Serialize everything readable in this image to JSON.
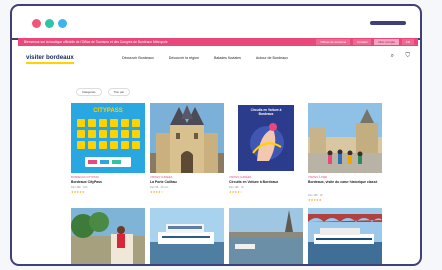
{
  "promo_bar": {
    "text": "Bienvenue sur la boutique officielle de l'Office de Tourisme et des Congrès de Bordeaux Métropole",
    "links": [
      "Offices de tourisme",
      "Contact",
      "Mon compte",
      "FR"
    ]
  },
  "header": {
    "logo": "visiter bordeaux",
    "nav": [
      "Découvrir Bordeaux",
      "Découvrir la région",
      "Balades fluviales",
      "Autour de Bordeaux"
    ]
  },
  "filters": [
    "Catégories",
    "Trier par"
  ],
  "cards": [
    {
      "category": "BORDEAUX CITYPASS",
      "title": "Bordeaux CityPass",
      "meta": "Dès 39€ · 24h",
      "stars": "★★★★★"
    },
    {
      "category": "VISITES GUIDÉES",
      "title": "La Porte Cailhau",
      "meta": "Dès 5€ · 45 min",
      "stars": "★★★★☆"
    },
    {
      "category": "VISITES GUIDÉES",
      "title": "Circuits en Voiture à Bordeaux",
      "meta": "Dès 19€ · 2h",
      "stars": "★★★★☆"
    },
    {
      "category": "VISITES À PIED",
      "title": "Bordeaux, visite du cœur historique classé",
      "meta": "Dès 15€ · 2h",
      "stars": "★★★★★"
    },
    {
      "category": "",
      "title": "",
      "meta": "",
      "stars": ""
    },
    {
      "category": "",
      "title": "",
      "meta": "",
      "stars": ""
    },
    {
      "category": "",
      "title": "",
      "meta": "",
      "stars": ""
    },
    {
      "category": "",
      "title": "",
      "meta": "",
      "stars": ""
    }
  ],
  "cover_texts": {
    "citypass": "CITYPASS",
    "circuits": "Circuits en Voiture à Bordeaux"
  },
  "icons": {
    "search": "search-icon",
    "cart": "cart-icon"
  },
  "colors": {
    "accent": "#e8487c",
    "frame": "#3f3f7a",
    "citypass_blue": "#28a7e0",
    "citypass_yellow": "#ffd200"
  }
}
